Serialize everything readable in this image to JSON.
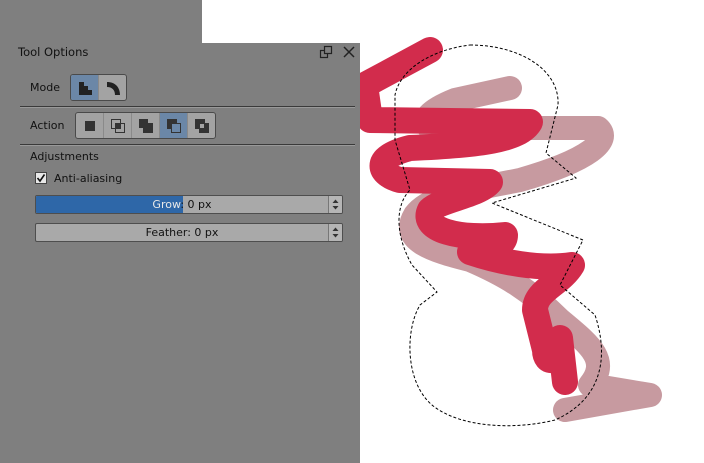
{
  "panel": {
    "title": "Tool Options",
    "mode_label": "Mode",
    "action_label": "Action",
    "adjustments_label": "Adjustments",
    "antialiasing_label": "Anti-aliasing",
    "antialiasing_checked": true,
    "grow": {
      "label": "Grow",
      "value_text": ": 0 px",
      "fill_fraction": 0.48
    },
    "feather": {
      "label": "Feather: 0 px"
    },
    "mode_buttons": [
      {
        "icon": "pixel-mode-icon",
        "active": true
      },
      {
        "icon": "vector-mode-icon",
        "active": false
      }
    ],
    "action_buttons": [
      {
        "icon": "replace-selection-icon",
        "active": false
      },
      {
        "icon": "intersect-selection-icon",
        "active": false
      },
      {
        "icon": "add-selection-icon",
        "active": false
      },
      {
        "icon": "subtract-selection-icon",
        "active": true
      },
      {
        "icon": "symmetric-difference-icon",
        "active": false
      }
    ]
  },
  "colors": {
    "panel_bg": "#7f7f7f",
    "active_button": "#6b87a7",
    "slider_fill": "#2e67a8",
    "stroke_primary": "#d22c4c",
    "stroke_secondary": "#c79aa0"
  }
}
